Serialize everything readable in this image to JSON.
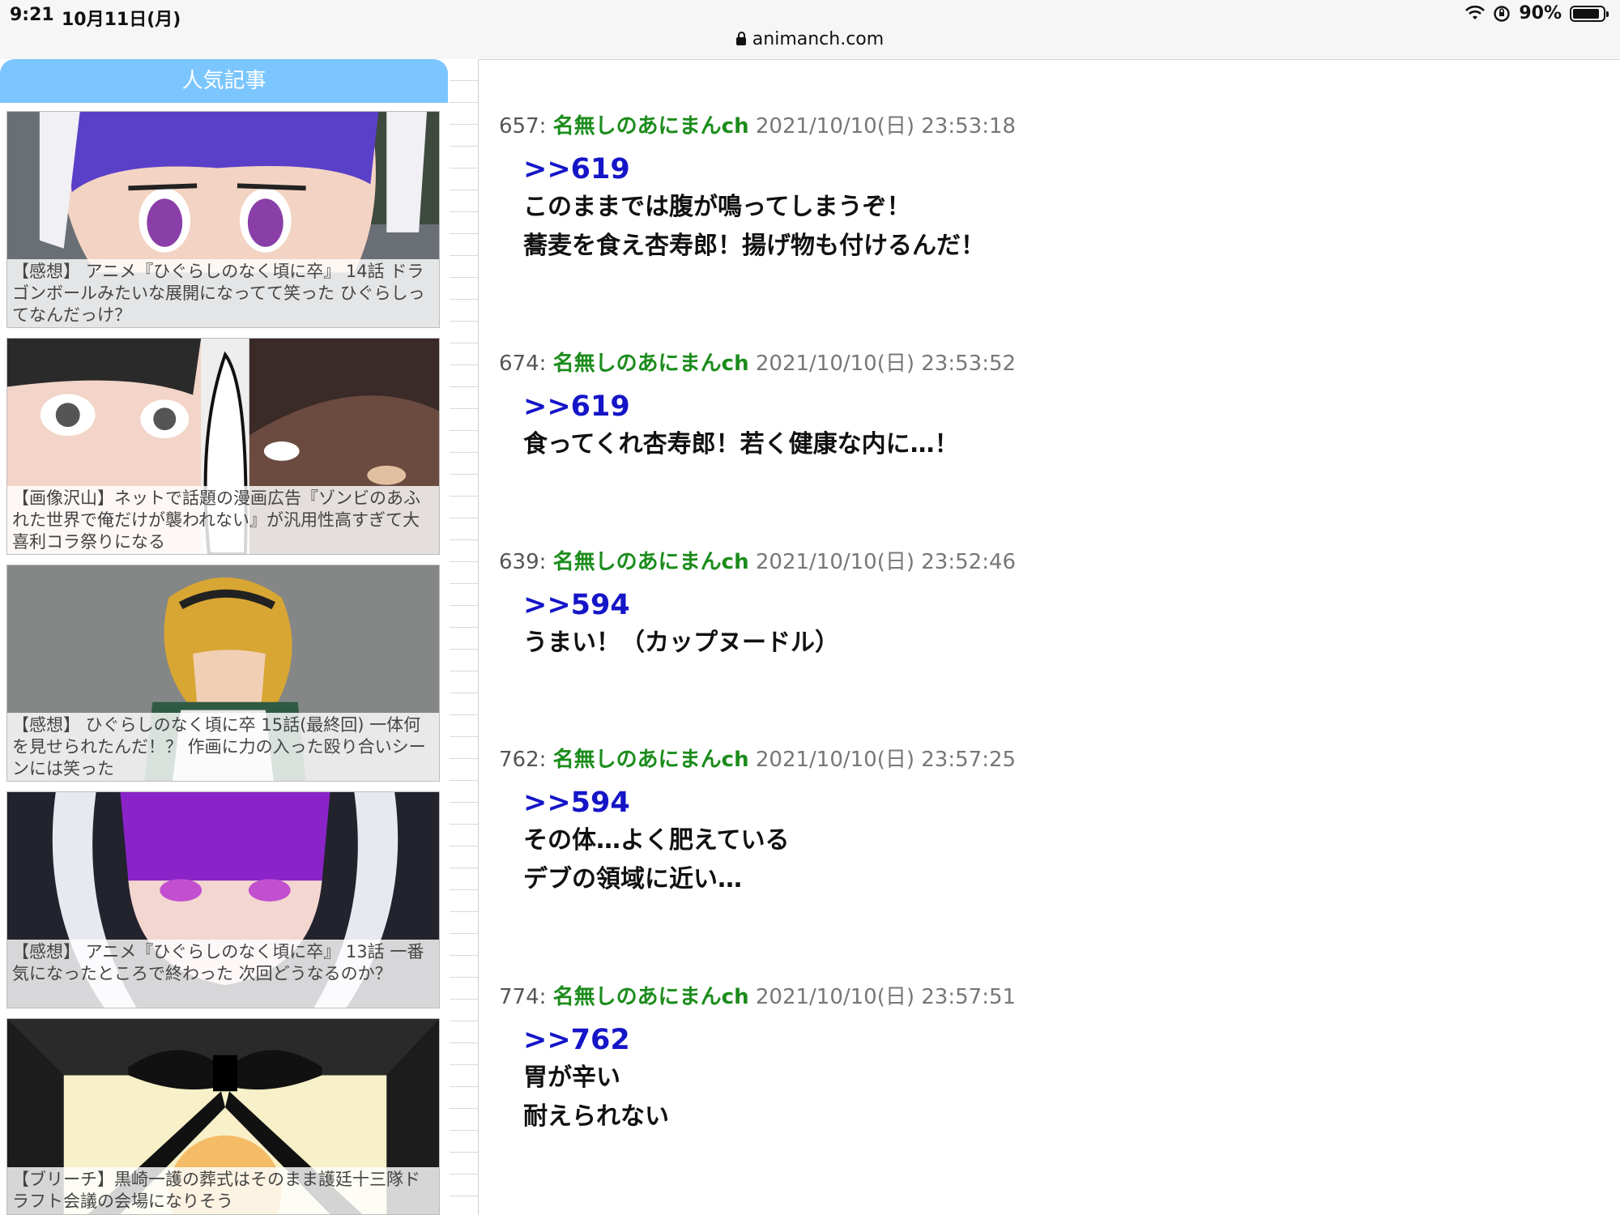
{
  "status_bar": {
    "time": "9:21",
    "date": "10月11日(月)",
    "battery_percent": "90%",
    "icons": [
      "wifi-icon",
      "orientation-lock-icon",
      "battery-icon"
    ]
  },
  "browser": {
    "url": "animanch.com"
  },
  "sidebar": {
    "title": "人気記事",
    "articles": [
      {
        "caption": "【感想】 アニメ『ひぐらしのなく頃に卒』 14話 ドラゴンボールみたいな展開になってて笑った ひぐらしってなんだっけ？"
      },
      {
        "caption": "【画像沢山】ネットで話題の漫画広告『ゾンビのあふれた世界で俺だけが襲われない』が汎用性高すぎて大喜利コラ祭りになる"
      },
      {
        "caption": "【感想】 ひぐらしのなく頃に卒 15話(最終回) 一体何を見せられたんだ！？ 作画に力の入った殴り合いシーンには笑った"
      },
      {
        "caption": "【感想】 アニメ『ひぐらしのなく頃に卒』 13話 一番気になったところで終わった 次回どうなるのか？"
      },
      {
        "caption": "【ブリーチ】黒崎一護の葬式はそのまま護廷十三隊ドラフト会議の会場になりそう"
      }
    ]
  },
  "posts": [
    {
      "number": "657:",
      "name": "名無しのあにまんch",
      "date": "2021/10/10(日) 23:53:18",
      "reply": ">>619",
      "lines": [
        "このままでは腹が鳴ってしまうぞ！",
        "蕎麦を食え杏寿郎！揚げ物も付けるんだ！"
      ]
    },
    {
      "number": "674:",
      "name": "名無しのあにまんch",
      "date": "2021/10/10(日) 23:53:52",
      "reply": ">>619",
      "lines": [
        "食ってくれ杏寿郎！若く健康な内に…！"
      ]
    },
    {
      "number": "639:",
      "name": "名無しのあにまんch",
      "date": "2021/10/10(日) 23:52:46",
      "reply": ">>594",
      "lines": [
        "うまい！（カップヌードル）"
      ]
    },
    {
      "number": "762:",
      "name": "名無しのあにまんch",
      "date": "2021/10/10(日) 23:57:25",
      "reply": ">>594",
      "lines": [
        "その体…よく肥えている",
        "デブの領域に近い…"
      ]
    },
    {
      "number": "774:",
      "name": "名無しのあにまんch",
      "date": "2021/10/10(日) 23:57:51",
      "reply": ">>762",
      "lines": [
        "胃が辛い",
        "耐えられない"
      ]
    }
  ]
}
